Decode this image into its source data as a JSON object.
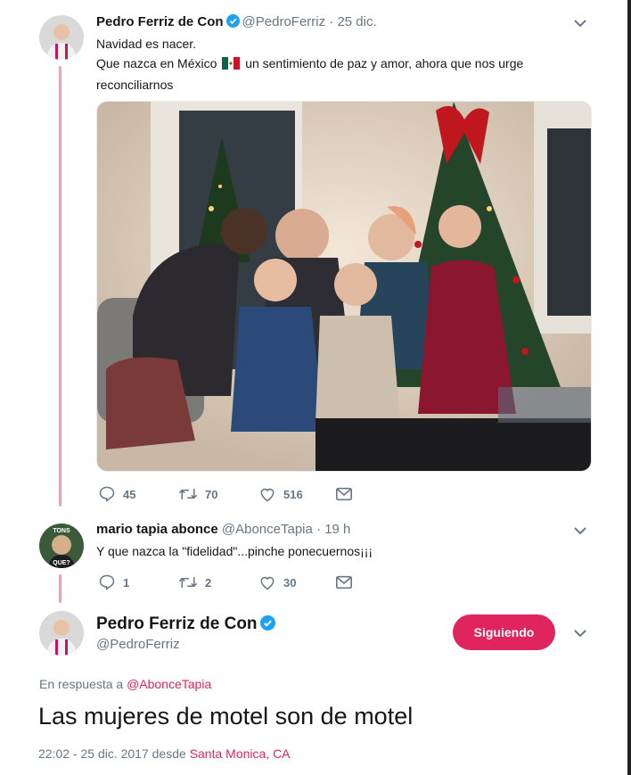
{
  "tweet1": {
    "name": "Pedro Ferriz de Con",
    "handle": "@PedroFerriz",
    "date": "· 25 dic.",
    "line1": "Navidad es nacer.",
    "line2_a": "Que nazca en México",
    "line2_b": "un sentimiento de paz y amor, ahora que nos urge",
    "line3": "reconciliarnos",
    "replies": "45",
    "retweets": "70",
    "likes": "516"
  },
  "reply": {
    "name": "mario tapia abonce",
    "handle": "@AbonceTapia",
    "date": "· 19 h",
    "text": "Y que nazca la \"fidelidad\"...pinche ponecuernos¡¡¡",
    "avatar_text_top": "TONS",
    "avatar_text_bottom": "QUE?",
    "replies": "1",
    "retweets": "2",
    "likes": "30"
  },
  "main": {
    "name": "Pedro Ferriz de Con",
    "handle": "@PedroFerriz",
    "follow_label": "Siguiendo",
    "reply_prefix": "En respuesta a",
    "reply_to": "@AbonceTapia",
    "text": "Las mujeres de motel son de motel",
    "timestamp": "22:02 - 25 dic. 2017 desde",
    "location": "Santa Monica, CA"
  },
  "colors": {
    "accent": "#e0245e",
    "verified": "#1da1f2",
    "muted": "#657786",
    "thread_line": "#e0a8b6"
  },
  "icons": [
    "reply-icon",
    "retweet-icon",
    "like-icon",
    "message-icon",
    "verified-icon",
    "chevron-down-icon",
    "mexico-flag-icon"
  ]
}
